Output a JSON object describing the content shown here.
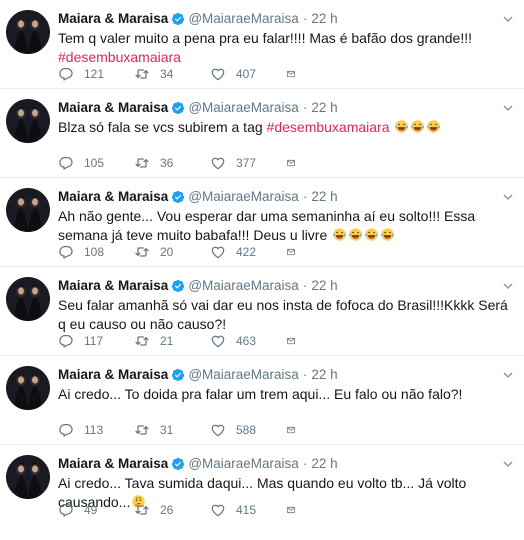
{
  "tweets": [
    {
      "name": "Maiara & Maraisa",
      "handle": "@MaiaraeMaraisa",
      "time": "22 h",
      "text": "Tem q valer muito a pena pra eu falar!!!! Mas é bafão dos grande!!!",
      "hashtag": "#desembuxamaiara",
      "hashtag_inline": false,
      "emoji_count": 0,
      "replies": "121",
      "retweets": "34",
      "likes": "407"
    },
    {
      "name": "Maiara & Maraisa",
      "handle": "@MaiaraeMaraisa",
      "time": "22 h",
      "text": "Blza  só fala se vcs subirem a tag ",
      "hashtag": "#desembuxamaiara",
      "hashtag_inline": true,
      "emoji_count": 3,
      "replies": "105",
      "retweets": "36",
      "likes": "377"
    },
    {
      "name": "Maiara & Maraisa",
      "handle": "@MaiaraeMaraisa",
      "time": "22 h",
      "text": "Ah não gente... Vou esperar dar uma semaninha aí eu solto!!! Essa semana já teve muito babafa!!! Deus u livre ",
      "hashtag": "",
      "hashtag_inline": false,
      "emoji_count": 4,
      "replies": "108",
      "retweets": "20",
      "likes": "422"
    },
    {
      "name": "Maiara & Maraisa",
      "handle": "@MaiaraeMaraisa",
      "time": "22 h",
      "text": "Seu falar amanhã só vai dar eu nos insta de fofoca do Brasil!!!Kkkk Será q eu causo ou não causo?!",
      "hashtag": "",
      "hashtag_inline": false,
      "emoji_count": 0,
      "replies": "117",
      "retweets": "21",
      "likes": "463"
    },
    {
      "name": "Maiara & Maraisa",
      "handle": "@MaiaraeMaraisa",
      "time": "22 h",
      "text": "Ai credo... To doida pra falar um trem aqui... Eu falo ou não falo?!",
      "hashtag": "",
      "hashtag_inline": false,
      "emoji_count": 0,
      "replies": "113",
      "retweets": "31",
      "likes": "588"
    },
    {
      "name": "Maiara & Maraisa",
      "handle": "@MaiaraeMaraisa",
      "time": "22 h",
      "text": "Ai credo... Tava sumida daqui... Mas quando eu volto tb... Já volto causando...",
      "hashtag": "",
      "hashtag_inline": false,
      "emoji_count": 0,
      "emoji_thinking": true,
      "replies": "49",
      "retweets": "26",
      "likes": "415"
    }
  ],
  "colors": {
    "text": "#14171a",
    "secondary": "#657786",
    "hashtag": "#e0245e",
    "verified": "#1da1f2",
    "divider": "#e6ecf0"
  },
  "icons": {
    "reply": "reply-icon",
    "retweet": "retweet-icon",
    "like": "heart-icon",
    "dm": "envelope-icon",
    "verified": "verified-badge-icon",
    "menu": "chevron-down-icon"
  }
}
